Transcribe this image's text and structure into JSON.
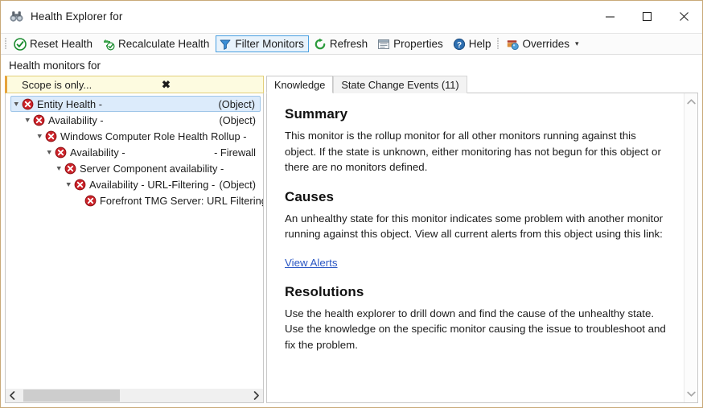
{
  "window": {
    "title": "Health Explorer for",
    "icon": "binoculars-icon",
    "minimize_label": "Minimize",
    "maximize_label": "Maximize",
    "close_label": "Close"
  },
  "toolbar": {
    "items": [
      {
        "label": "Reset Health",
        "icon": "green-check-circle-icon",
        "selected": false,
        "caret": false
      },
      {
        "label": "Recalculate Health",
        "icon": "recalculate-icon",
        "selected": false,
        "caret": false
      },
      {
        "label": "Filter Monitors",
        "icon": "funnel-icon",
        "selected": true,
        "caret": false
      },
      {
        "label": "Refresh",
        "icon": "refresh-icon",
        "selected": false,
        "caret": false
      },
      {
        "label": "Properties",
        "icon": "properties-icon",
        "selected": false,
        "caret": false
      },
      {
        "label": "Help",
        "icon": "help-icon",
        "selected": false,
        "caret": false
      },
      {
        "label": "Overrides",
        "icon": "overrides-icon",
        "selected": false,
        "caret": true
      }
    ],
    "caret_glyph": "▾"
  },
  "subheader": {
    "text": "Health monitors for"
  },
  "scope": {
    "text": "Scope is only...",
    "close_glyph": "✖"
  },
  "tree": {
    "nodes": [
      {
        "indent": 0,
        "expander": true,
        "label": "Entity Health -",
        "right": "(Object)",
        "selected": true,
        "state": "critical-icon"
      },
      {
        "indent": 1,
        "expander": true,
        "label": "Availability -",
        "right": "(Object)",
        "selected": false,
        "state": "critical-icon"
      },
      {
        "indent": 2,
        "expander": true,
        "label": "Windows Computer Role Health Rollup -",
        "right": "",
        "selected": false,
        "state": "critical-icon"
      },
      {
        "indent": 3,
        "expander": true,
        "label": "Availability -",
        "right": "- Firewall",
        "selected": false,
        "state": "critical-icon"
      },
      {
        "indent": 4,
        "expander": true,
        "label": "Server Component availability -",
        "right": "",
        "selected": false,
        "state": "critical-icon"
      },
      {
        "indent": 5,
        "expander": true,
        "label": "Availability - URL-Filtering -",
        "right": "(Object)",
        "selected": false,
        "state": "critical-icon"
      },
      {
        "indent": 6,
        "expander": false,
        "label": "Forefront TMG Server: URL Filtering - Server",
        "right": "",
        "selected": false,
        "state": "critical-icon"
      }
    ],
    "hscroll": {
      "left_glyph": "‹",
      "right_glyph": "›"
    }
  },
  "tabs": [
    {
      "label": "Knowledge",
      "active": true
    },
    {
      "label": "State Change Events (11)",
      "active": false
    }
  ],
  "knowledge": {
    "summary_heading": "Summary",
    "summary_text": "This monitor is the rollup monitor for all other monitors running against this object. If the state is unknown, either monitoring has not begun for this object or there are no monitors defined.",
    "causes_heading": "Causes",
    "causes_text": "An unhealthy state for this monitor indicates some problem with another monitor running against this object. View all current alerts from this object using this link:",
    "view_alerts_link": "View Alerts",
    "resolutions_heading": "Resolutions",
    "resolutions_text": "Use the health explorer to drill down and find the cause of the unhealthy state. Use the knowledge on the specific monitor causing the issue to troubleshoot and fix the problem.",
    "vscroll": {
      "up_glyph": "∧",
      "down_glyph": "∨"
    }
  },
  "colors": {
    "accent_blue": "#4a9fe0",
    "selection_blue": "#dcebfb",
    "critical_red": "#cc2229",
    "scope_yellow": "#fdfbe0",
    "scope_orange": "#e6a33c",
    "link_blue": "#2b57c4",
    "window_border": "#c9a979"
  }
}
